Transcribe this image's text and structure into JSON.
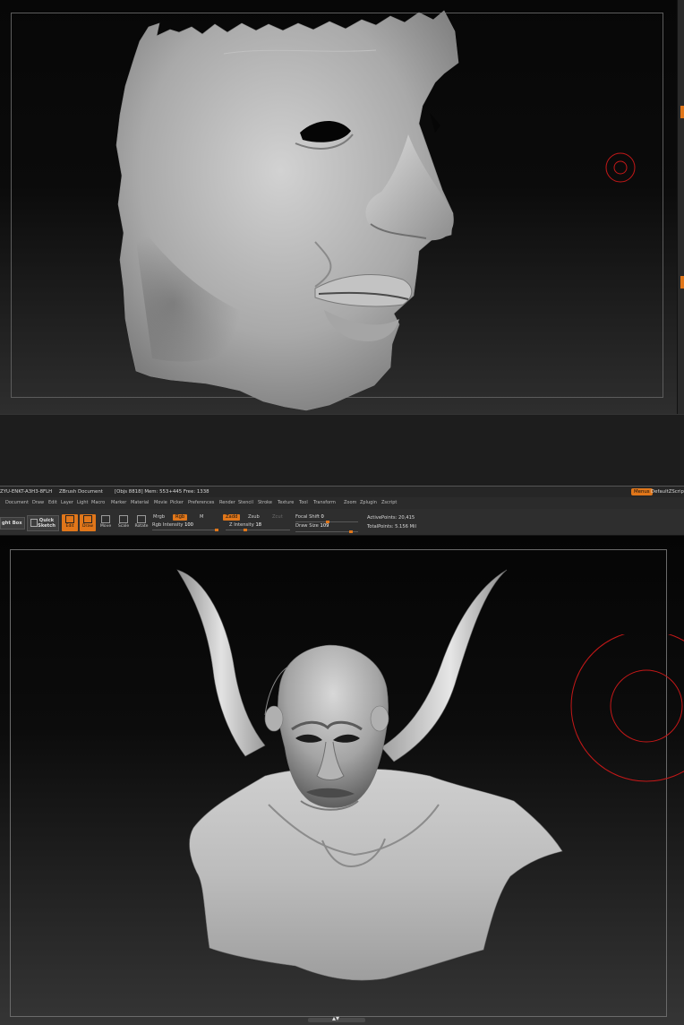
{
  "titlebar": {
    "project_id": "ZYU-ENKT-A3H3-8FLH",
    "doc_title": "ZBrush Document",
    "stats": "[Objs 8818] Mem: 553+445 Free: 1338",
    "menus_label": "Menus",
    "script_name": "DefaultZScript"
  },
  "menubar": {
    "items": [
      "Document",
      "Draw",
      "Edit",
      "Layer",
      "Light",
      "Macro",
      "Marker",
      "Material",
      "Movie",
      "Picker",
      "Preferences",
      "Render",
      "Stencil",
      "Stroke",
      "Texture",
      "Tool",
      "Transform",
      "Zoom",
      "Zplugin",
      "Zscript"
    ]
  },
  "toolbar": {
    "lightbox_label": "ght Box",
    "quicksketch_line1": "Quick",
    "quicksketch_line2": "Sketch",
    "tools": [
      {
        "label": "Edit",
        "active": true
      },
      {
        "label": "Draw",
        "active": true
      },
      {
        "label": "Move",
        "active": false
      },
      {
        "label": "Scale",
        "active": false
      },
      {
        "label": "Rotate",
        "active": false
      }
    ],
    "mrgb": "Mrgb",
    "rgb": "Rgb",
    "m": "M",
    "rgb_intensity_label": "Rgb Intensity",
    "rgb_intensity_value": "100",
    "zadd": "Zadd",
    "zsub": "Zsub",
    "zcut": "Zcut",
    "z_intensity_label": "Z Intensity",
    "z_intensity_value": "18",
    "focal_shift_label": "Focal Shift",
    "focal_shift_value": "0",
    "draw_size_label": "Draw Size",
    "draw_size_value": "109",
    "active_points_label": "ActivePoints:",
    "active_points_value": "20,415",
    "total_points_label": "TotalPoints:",
    "total_points_value": "5.156 Mil"
  },
  "colors": {
    "accent": "#e0761a",
    "brush_cursor": "#c41818",
    "panel": "#2e2e2e",
    "clay": "#b8b8b8"
  },
  "icons": {
    "drag_handle": "double-chevron-icon",
    "brush_cursor": "brush-cursor-ring-icon",
    "quicksketch": "sketch-icon"
  }
}
